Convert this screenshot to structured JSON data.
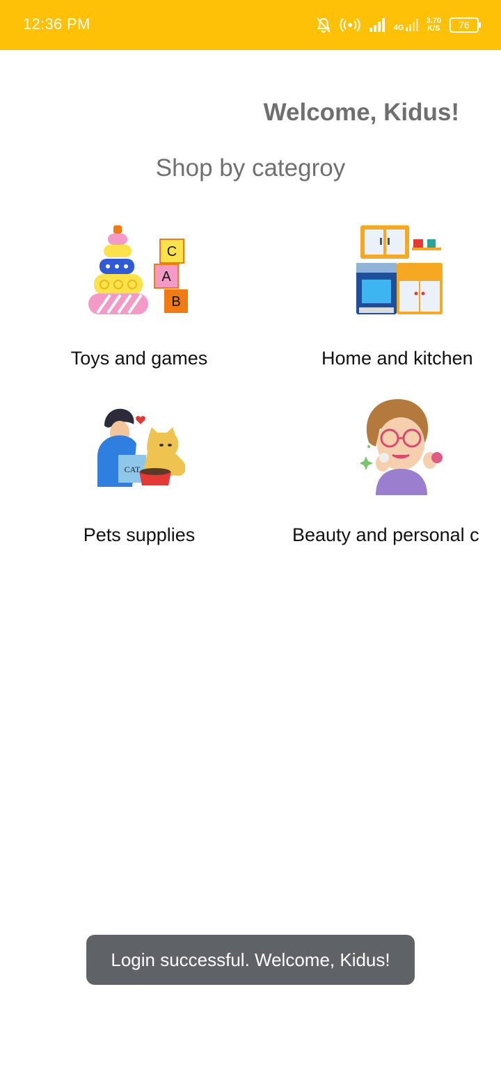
{
  "status_bar": {
    "time": "12:36 PM",
    "network_type": "4G",
    "net_speed_value": "3.70",
    "net_speed_unit": "K/S",
    "battery": "76",
    "icons": [
      "bell-off-icon",
      "hotspot-icon",
      "signal-icon",
      "signal-4g-icon",
      "battery-icon"
    ]
  },
  "header": {
    "welcome": "Welcome, Kidus!",
    "subtitle": "Shop by categroy"
  },
  "categories": [
    {
      "label": "Toys and games",
      "icon": "toys-illustration"
    },
    {
      "label": "Home and kitchen",
      "icon": "kitchen-illustration"
    },
    {
      "label": "Pets supplies",
      "icon": "pet-owner-illustration"
    },
    {
      "label": "Beauty and personal care",
      "icon": "beauty-illustration"
    }
  ],
  "toast": {
    "message": "Login successful. Welcome, Kidus!"
  },
  "colors": {
    "status_bar": "#FFC107",
    "toast_bg": "#5f6267",
    "heading": "#6f6f6f"
  }
}
